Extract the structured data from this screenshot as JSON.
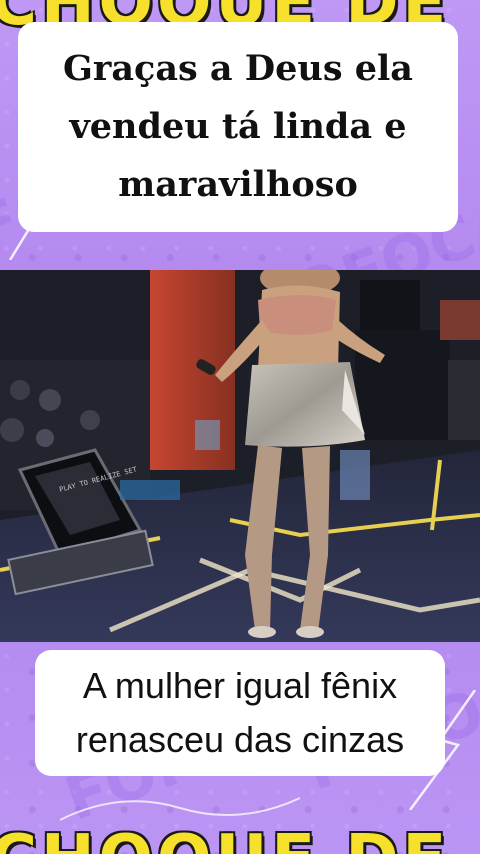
{
  "captions": {
    "top_lines": [
      "Graças a Deus ela",
      "vendeu tá linda e",
      "maravilhoso"
    ],
    "bottom_lines": [
      "A mulher igual fênix",
      "renasceu das cinzas"
    ]
  },
  "banner": {
    "logo_text": "CHOQUE DE"
  },
  "background_watermark": "FOFOCA",
  "colors": {
    "background": "#b78ef0",
    "banner_yellow": "#f7e02c",
    "caption_bg": "#ffffff"
  },
  "video": {
    "monitor_text": "PLAY TO REALIZE SET"
  }
}
